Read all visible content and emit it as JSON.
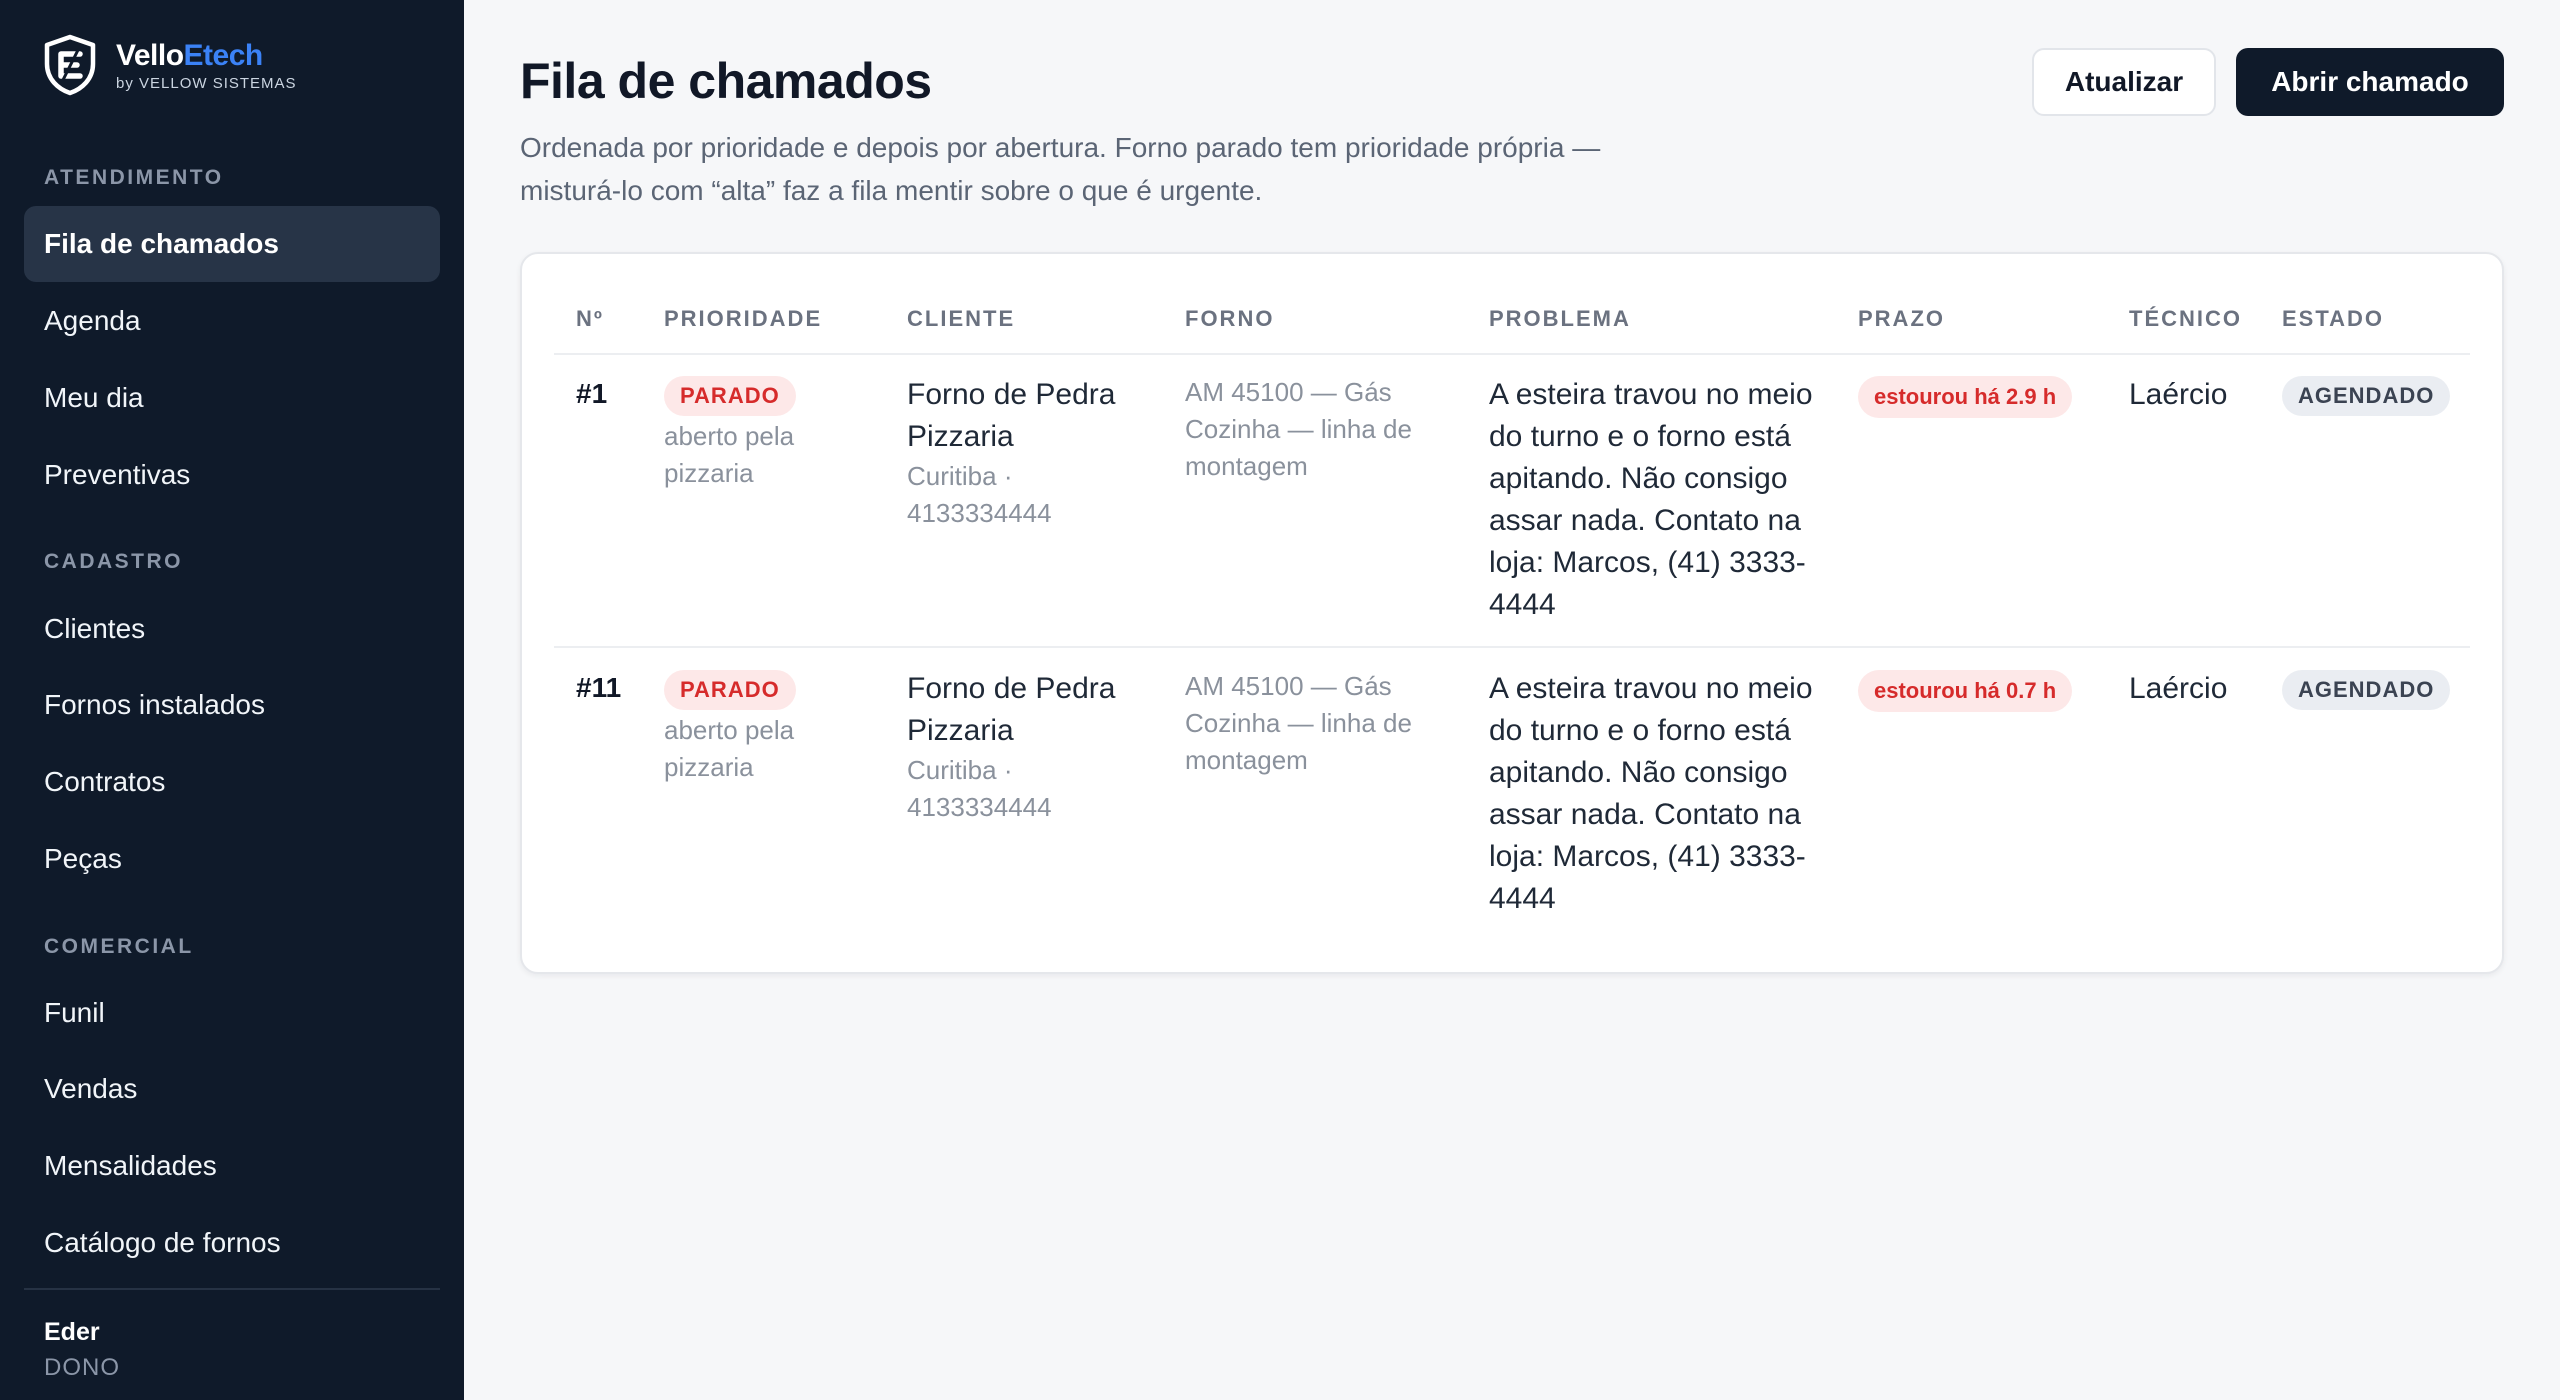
{
  "brand": {
    "name_part1": "Vello",
    "name_part2": "Etech",
    "byline": "by VELLOW SISTEMAS"
  },
  "sidebar": {
    "sections": [
      {
        "title": "ATENDIMENTO",
        "items": [
          "Fila de chamados",
          "Agenda",
          "Meu dia",
          "Preventivas"
        ]
      },
      {
        "title": "CADASTRO",
        "items": [
          "Clientes",
          "Fornos instalados",
          "Contratos",
          "Peças"
        ]
      },
      {
        "title": "COMERCIAL",
        "items": [
          "Funil",
          "Vendas",
          "Mensalidades",
          "Catálogo de fornos"
        ]
      }
    ],
    "active_item": "Fila de chamados",
    "user": {
      "name": "Eder",
      "role": "DONO"
    }
  },
  "header": {
    "title": "Fila de chamados",
    "subtitle": "Ordenada por prioridade e depois por abertura. Forno parado tem prioridade própria — misturá-lo com “alta” faz a fila mentir sobre o que é urgente.",
    "refresh_label": "Atualizar",
    "open_ticket_label": "Abrir chamado"
  },
  "table": {
    "columns": [
      "Nº",
      "PRIORIDADE",
      "CLIENTE",
      "FORNO",
      "PROBLEMA",
      "PRAZO",
      "TÉCNICO",
      "ESTADO"
    ],
    "rows": [
      {
        "number": "#1",
        "priority": "PARADO",
        "priority_note": "aberto pela pizzaria",
        "client_name": "Forno de Pedra Pizzaria",
        "client_info": "Curitiba · 4133334444",
        "oven": "AM 45100 — Gás Cozinha — linha de montagem",
        "problem": "A esteira travou no meio do turno e o forno está apitando. Não consigo assar nada. Contato na loja: Marcos, (41) 3333-4444",
        "deadline": "estourou há 2.9 h",
        "technician": "Laércio",
        "status": "AGENDADO"
      },
      {
        "number": "#11",
        "priority": "PARADO",
        "priority_note": "aberto pela pizzaria",
        "client_name": "Forno de Pedra Pizzaria",
        "client_info": "Curitiba · 4133334444",
        "oven": "AM 45100 — Gás Cozinha — linha de montagem",
        "problem": "A esteira travou no meio do turno e o forno está apitando. Não consigo assar nada. Contato na loja: Marcos, (41) 3333-4444",
        "deadline": "estourou há 0.7 h",
        "technician": "Laércio",
        "status": "AGENDADO"
      }
    ]
  },
  "colors": {
    "sidebar_bg": "#0f1a2a",
    "accent": "#3b82f6",
    "danger": "#d62b2b",
    "page_bg": "#f6f7f9"
  }
}
